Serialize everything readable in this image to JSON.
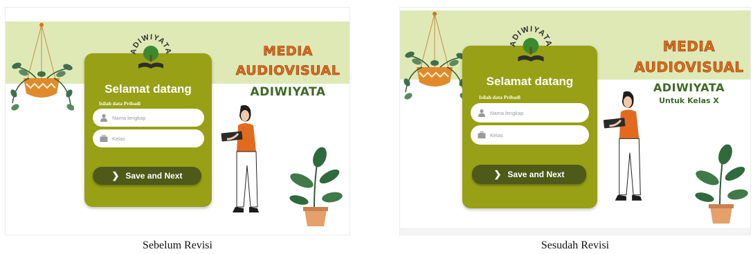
{
  "panels": {
    "before": {
      "logo_text": "ADIWIYATA",
      "title_line1": "MEDIA",
      "title_line2": "AUDIOVISUAL",
      "title_line3": "ADIWIYATA",
      "welcome": "Selamat datang",
      "form_label": "Isilah data Pribadi",
      "name_placeholder": "Nama lengkap",
      "class_placeholder": "Kelas",
      "button_label": "Save and Next"
    },
    "after": {
      "logo_text": "ADIWIYATA",
      "title_line1": "MEDIA",
      "title_line2": "AUDIOVISUAL",
      "title_line3": "ADIWIYATA",
      "title_line4": "Untuk Kelas X",
      "welcome": "Selamat datang",
      "form_label": "Isilah data Pribadi",
      "name_placeholder": "Nama lengkap",
      "class_placeholder": "Kelas",
      "button_label": "Save and Next"
    }
  },
  "captions": {
    "before": "Sebelum Revisi",
    "after": "Sesudah Revisi"
  },
  "colors": {
    "band": "#dfe9b6",
    "card": "#98a015",
    "button": "#4d5a1a",
    "title_orange": "#e36a19",
    "title_green": "#3e6a26"
  },
  "icons": {
    "name_field": "user-icon",
    "class_field": "briefcase-icon",
    "button": "chevron-right-icon"
  }
}
